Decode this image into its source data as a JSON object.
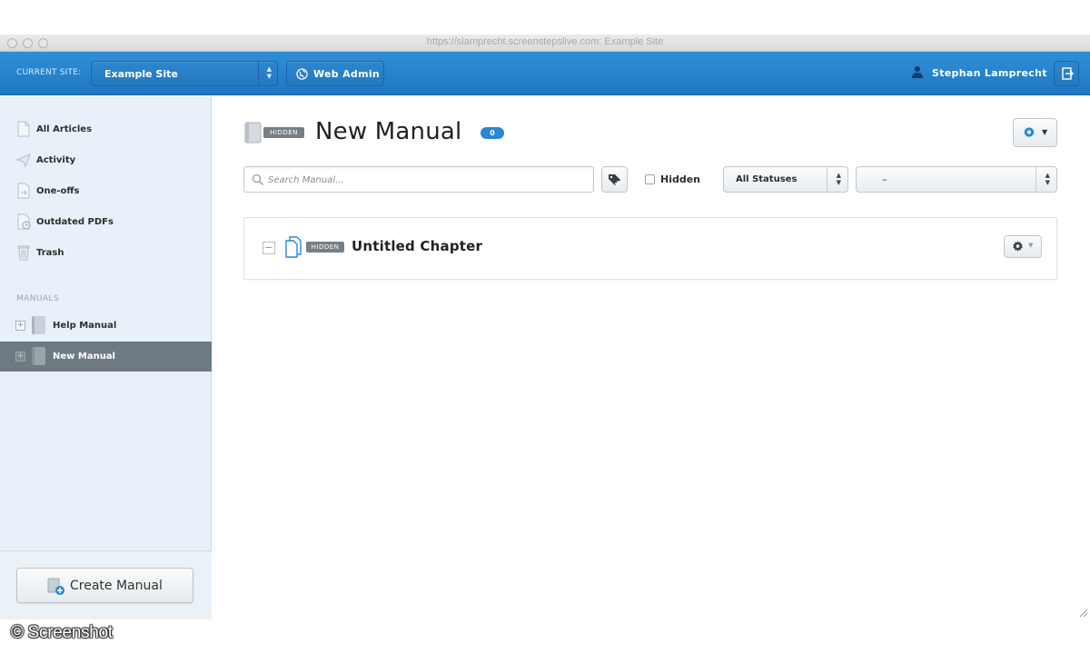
{
  "window": {
    "url": "https://slamprecht.screenstepslive.com: Example Site"
  },
  "topbar": {
    "current_site_label": "CURRENT SITE:",
    "site_value": "Example Site",
    "web_admin_label": "Web Admin",
    "user_name": "Stephan Lamprecht"
  },
  "sidebar": {
    "nav": [
      {
        "label": "All Articles",
        "icon": "document-icon"
      },
      {
        "label": "Activity",
        "icon": "paper-plane-icon"
      },
      {
        "label": "One-offs",
        "icon": "one-off-icon"
      },
      {
        "label": "Outdated PDFs",
        "icon": "clock-document-icon"
      },
      {
        "label": "Trash",
        "icon": "trash-icon"
      }
    ],
    "manuals_label": "MANUALS",
    "manuals": [
      {
        "label": "Help Manual",
        "active": false
      },
      {
        "label": "New Manual",
        "active": true
      }
    ],
    "create_manual_label": "Create Manual"
  },
  "main": {
    "hidden_badge": "HIDDEN",
    "title": "New Manual",
    "count": "0",
    "search_placeholder": "Search Manual...",
    "hidden_filter_label": "Hidden",
    "status_select": "All Statuses",
    "second_select": "–",
    "chapters": [
      {
        "title": "Untitled Chapter",
        "badge": "HIDDEN"
      }
    ]
  },
  "watermark": "© Screenshot",
  "colors": {
    "topbar_blue": "#2581c9",
    "sidebar_bg": "#e8f1f9",
    "active_item": "#6e7a82",
    "badge_blue": "#2b86d3",
    "hidden_badge": "#777f86"
  }
}
